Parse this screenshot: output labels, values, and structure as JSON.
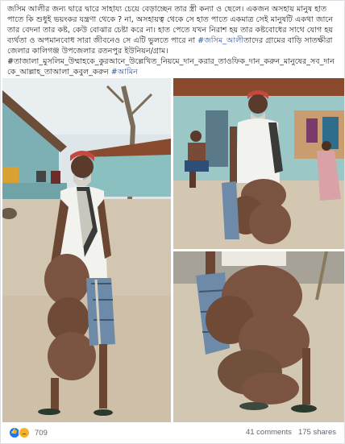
{
  "post": {
    "text_main": "জসিম আলীর জন্য দ্বারে দ্বারে সাহায্য চেয়ে বেড়াচ্ছেন তার স্ত্রী কন্যা ও ছেলে। একজন অসহায় মানুষ হাত পাতে কি শুধুই ভয়ংকর যন্ত্রণা থেকে ? না, অসহায়ত্ব থেকে সে হাত পাতে একমাত্র সেই মানুষটি একথা জানে তার বেদনা তার কষ্ট, কেউ বোঝার চেষ্টা করে না। হাত পেতে যখন নিরাশ হয় তার কষ্টবোধের সাথে যোগ হয় ব্যর্থতা ও অপমানবোধ সারা জীবনেও সে এটি ভুলতে পারে না ",
    "mention": "#জসিম_আলী",
    "text_mid": "তাদের গ্রামের বাড়ি সাতক্ষীরা জেলার কালিগঞ্জ উপজেলার রতনপুর ইউনিয়ন/গ্রাম।",
    "hashtags": "#তাজালা_মুসলিম_উম্মাহকে_কুরআনে_উল্লেখিত_নিয়মে_দান_করার_তাওফিক_দান_করুন_মানুষের_সব_দানকে_আল্লাহ_তাআলা_কবুল_করুন",
    "amin": "#আমিন"
  },
  "photos": [
    {
      "label": "photo-left"
    },
    {
      "label": "photo-top-right"
    },
    {
      "label": "photo-bottom-right"
    }
  ],
  "footer": {
    "reaction_count": "709",
    "comments": "41 comments",
    "shares": "175 shares"
  }
}
